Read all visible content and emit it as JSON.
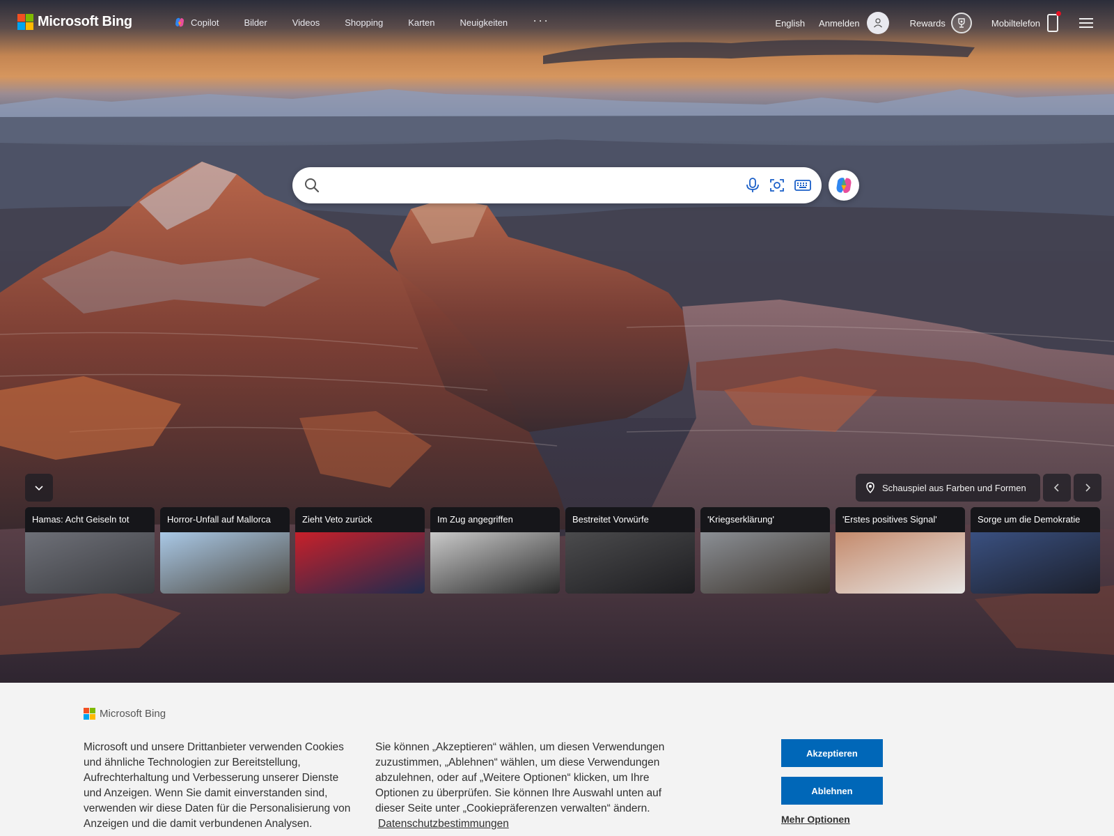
{
  "brand": {
    "name": "Microsoft Bing",
    "colors": {
      "red": "#f25022",
      "green": "#7fba00",
      "blue": "#00a4ef",
      "yellow": "#ffb900"
    }
  },
  "nav": {
    "items": [
      {
        "label": "Copilot",
        "icon": "copilot-icon"
      },
      {
        "label": "Bilder"
      },
      {
        "label": "Videos"
      },
      {
        "label": "Shopping"
      },
      {
        "label": "Karten"
      },
      {
        "label": "Neuigkeiten"
      }
    ],
    "more": "···"
  },
  "header_right": {
    "language": "English",
    "signin": "Anmelden",
    "rewards": "Rewards",
    "mobile": "Mobiltelefon"
  },
  "search": {
    "placeholder": "",
    "tools": [
      "microphone-icon",
      "visual-search-icon",
      "keyboard-icon"
    ]
  },
  "image_info": {
    "location_label": "Schauspiel aus Farben und Formen"
  },
  "news": [
    {
      "title": "Hamas: Acht Geiseln tot",
      "tone": [
        "#6e7078",
        "#3a3b3f"
      ]
    },
    {
      "title": "Horror-Unfall auf Mallorca",
      "tone": [
        "#a9c8e6",
        "#4e4a42"
      ]
    },
    {
      "title": "Zieht Veto zurück",
      "tone": [
        "#c8202a",
        "#1f2b4e"
      ]
    },
    {
      "title": "Im Zug angegriffen",
      "tone": [
        "#c9c9c9",
        "#2a2a2a"
      ]
    },
    {
      "title": "Bestreitet Vorwürfe",
      "tone": [
        "#4b4b4d",
        "#1d1d20"
      ]
    },
    {
      "title": "'Kriegserklärung'",
      "tone": [
        "#8b8f95",
        "#3b332b"
      ]
    },
    {
      "title": "'Erstes positives Signal'",
      "tone": [
        "#c48a6c",
        "#e8e6e4"
      ]
    },
    {
      "title": "Sorge um die Demokratie",
      "tone": [
        "#3a5080",
        "#1b1f2b"
      ]
    }
  ],
  "cookie": {
    "logo_text": "Microsoft Bing",
    "paragraph1": "Microsoft und unsere Drittanbieter verwenden Cookies und ähnliche Technologien zur Bereitstellung, Aufrechterhaltung und Verbesserung unserer Dienste und Anzeigen. Wenn Sie damit einverstanden sind, verwenden wir diese Daten für die Personalisierung von Anzeigen und die damit verbundenen Analysen.",
    "paragraph2": "Sie können „Akzeptieren“ wählen, um diesen Verwendungen zuzustimmen, „Ablehnen“ wählen, um diese Verwendungen abzulehnen, oder auf „Weitere Optionen“ klicken, um Ihre Optionen zu überprüfen. Sie können Ihre Auswahl unten auf dieser Seite unter „Cookiepräferenzen verwalten“ ändern.",
    "privacy_link": "Datenschutzbestimmungen",
    "accept": "Akzeptieren",
    "reject": "Ablehnen",
    "more_options": "Mehr Optionen",
    "accent": "#0067b8"
  }
}
